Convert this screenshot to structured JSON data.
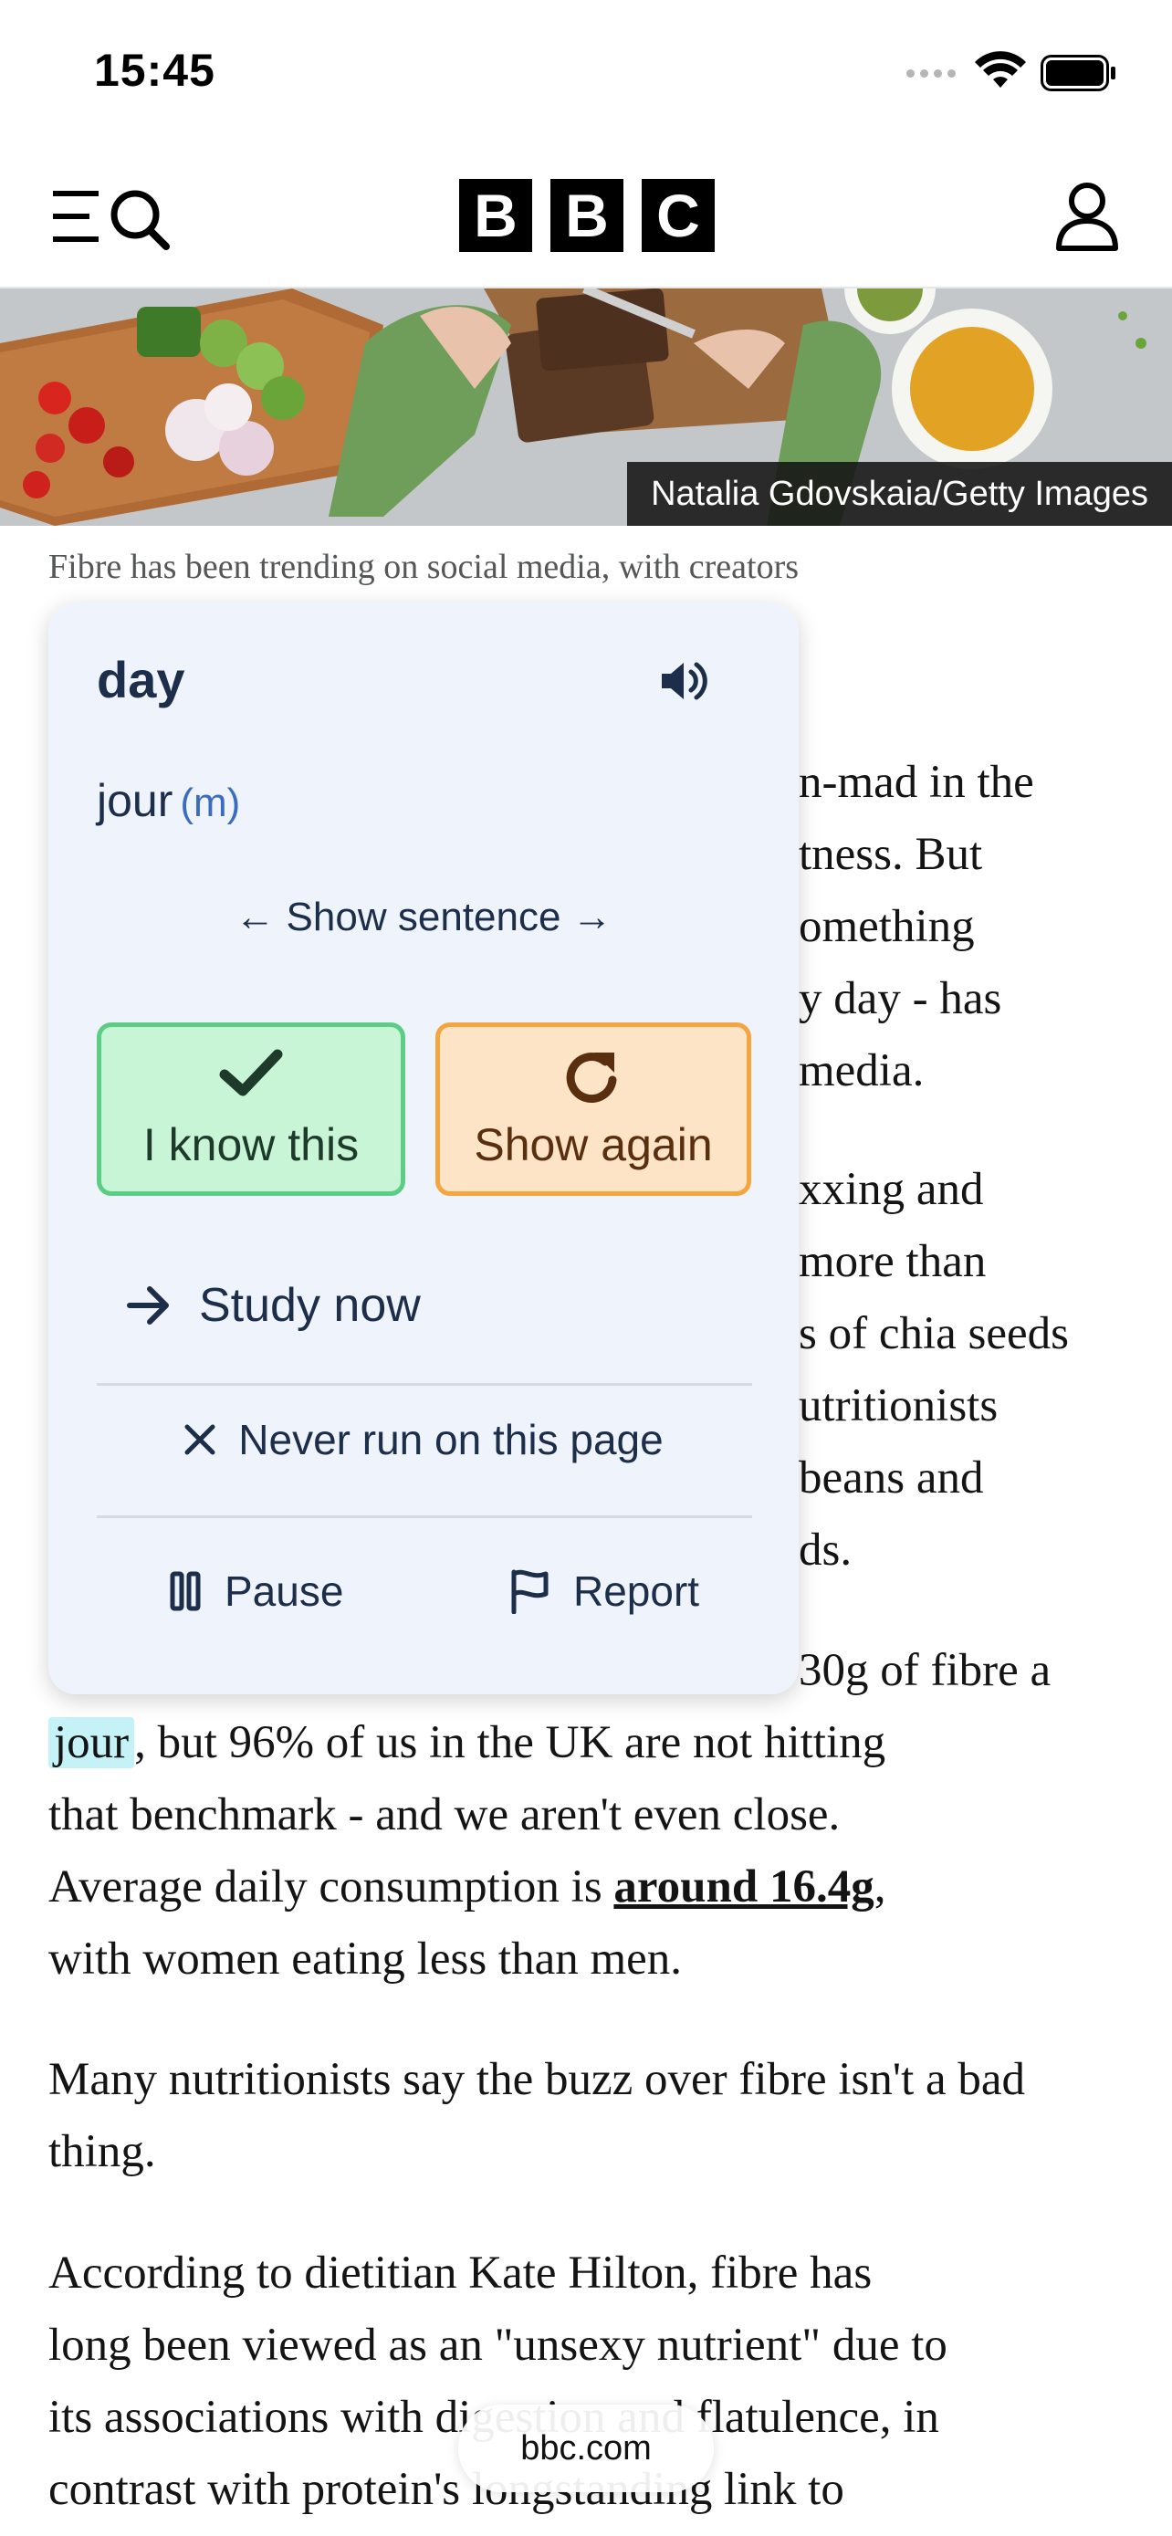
{
  "status_bar": {
    "time": "15:45"
  },
  "header": {
    "logo_letters": [
      "B",
      "B",
      "C"
    ]
  },
  "hero": {
    "credit": "Natalia Gdovskaia/Getty Images"
  },
  "caption": {
    "text": "Fibre has been trending on social media, with creators"
  },
  "article": {
    "fragments_right": [
      "n-mad in the",
      "tness. But",
      "omething",
      "y day - has",
      "media.",
      "xxing and",
      "more than",
      "s of chia seeds",
      "utritionists",
      " beans and",
      "ds."
    ],
    "line_30g": "30g of fibre a",
    "highlight_word": "jour",
    "para1_rest_line1": ", but 96% of us in the UK are not hitting",
    "para1_line2": "that benchmark - and we aren't even close.",
    "para1_line3_pre": "Average daily consumption is ",
    "para1_link": "around 16.4g",
    "para1_line3_post": ",",
    "para1_line4": "with women eating less than men.",
    "para2": "Many nutritionists say the buzz over fibre isn't a bad thing.",
    "para3_line1": "According to dietitian Kate Hilton, fibre has",
    "para3_line2": "long been viewed as an \"unsexy nutrient\" due to",
    "para3_line3": "its associations with digestion and flatulence, in",
    "para3_line4": "contrast with protein's longstanding link to"
  },
  "popup": {
    "word": "day",
    "translation": "jour",
    "gender": "(m)",
    "show_sentence": "← Show sentence →",
    "know_label": "I know this",
    "again_label": "Show again",
    "study_label": "Study now",
    "never_label": "Never run on this page",
    "pause_label": "Pause",
    "report_label": "Report",
    "colors": {
      "know_bg": "#c7f5d6",
      "know_border": "#5ccd85",
      "again_bg": "#fde4c6",
      "again_border": "#f3a53f",
      "panel": "#eff3fc"
    }
  },
  "browser": {
    "url": "bbc.com"
  }
}
